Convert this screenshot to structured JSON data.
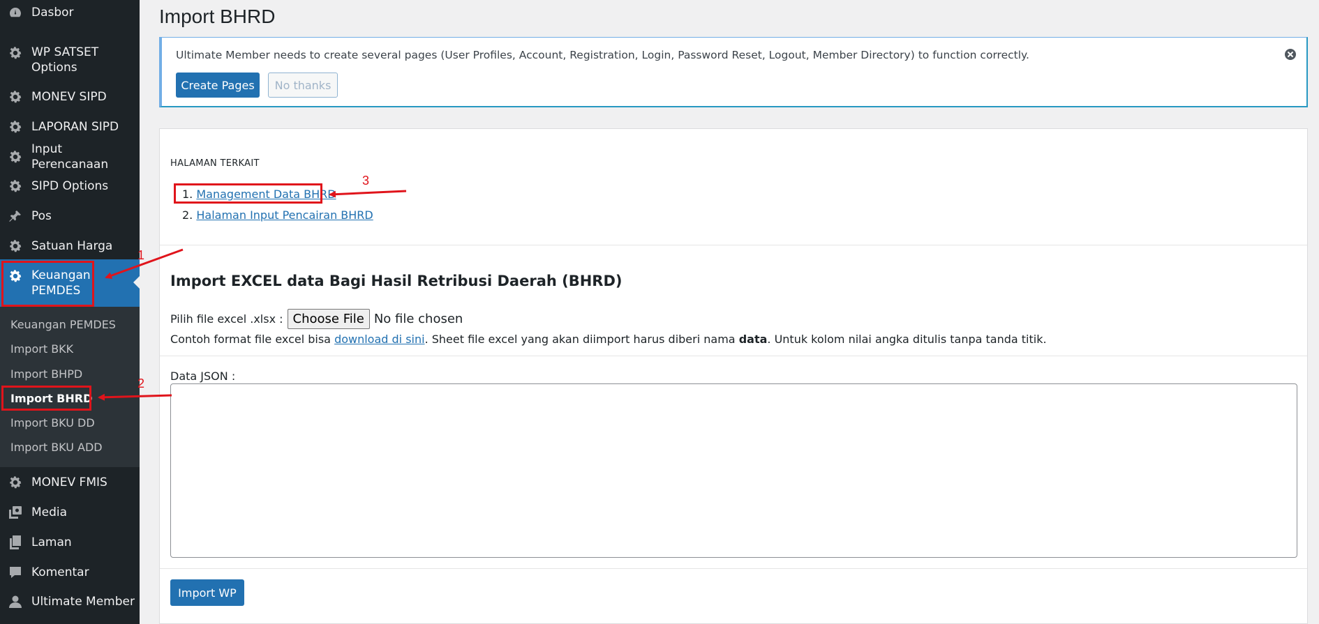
{
  "sidebar": {
    "items": [
      {
        "label": "Dasbor",
        "icon": "dashboard-icon"
      },
      {
        "label": "WP SATSET Options",
        "icon": "gear-icon"
      },
      {
        "label": "MONEV SIPD",
        "icon": "gear-icon"
      },
      {
        "label": "LAPORAN SIPD",
        "icon": "gear-icon"
      },
      {
        "label": "Input Perencanaan",
        "icon": "gear-icon"
      },
      {
        "label": "SIPD Options",
        "icon": "gear-icon"
      },
      {
        "label": "Pos",
        "icon": "pin-icon"
      },
      {
        "label": "Satuan Harga",
        "icon": "gear-icon"
      },
      {
        "label": "Keuangan PEMDES",
        "icon": "gear-icon"
      },
      {
        "label": "MONEV FMIS",
        "icon": "gear-icon"
      },
      {
        "label": "Media",
        "icon": "media-icon"
      },
      {
        "label": "Laman",
        "icon": "page-icon"
      },
      {
        "label": "Komentar",
        "icon": "comment-icon"
      },
      {
        "label": "Ultimate Member",
        "icon": "user-icon"
      }
    ],
    "submenu": [
      {
        "label": "Keuangan PEMDES"
      },
      {
        "label": "Import BKK"
      },
      {
        "label": "Import BHPD"
      },
      {
        "label": "Import BHRD"
      },
      {
        "label": "Import BKU DD"
      },
      {
        "label": "Import BKU ADD"
      }
    ],
    "item1_line2": "Options",
    "item1_line1": "WP SATSET",
    "active_line1": "Keuangan",
    "active_line2": "PEMDES"
  },
  "page": {
    "title": "Import BHRD"
  },
  "notice": {
    "message": "Ultimate Member needs to create several pages (User Profiles, Account, Registration, Login, Password Reset, Logout, Member Directory) to function correctly.",
    "create_label": "Create Pages",
    "dismiss_label": "No thanks"
  },
  "related": {
    "heading": "HALAMAN TERKAIT",
    "links": [
      {
        "num": "1.",
        "label": "Management Data BHRD"
      },
      {
        "num": "2.",
        "label": "Halaman Input Pencairan BHRD"
      }
    ]
  },
  "import": {
    "heading": "Import EXCEL data Bagi Hasil Retribusi Daerah (BHRD)",
    "file_label": "Pilih file excel .xlsx :",
    "choose_label": "Choose File",
    "no_file": "No file chosen",
    "hint_pre": "Contoh format file excel bisa ",
    "hint_link": "download di sini",
    "hint_mid": ". Sheet file excel yang akan diimport harus diberi nama ",
    "hint_bold": "data",
    "hint_post": ". Untuk kolom nilai angka ditulis tanpa tanda titik.",
    "json_label": "Data JSON :",
    "json_value": "",
    "submit_label": "Import WP"
  },
  "annotations": {
    "n1": "1",
    "n2": "2",
    "n3": "3",
    "color": "#e0141b"
  },
  "colors": {
    "sidebar_bg": "#1d2327",
    "accent": "#2271b1",
    "submenu_bg": "#2c3338"
  }
}
